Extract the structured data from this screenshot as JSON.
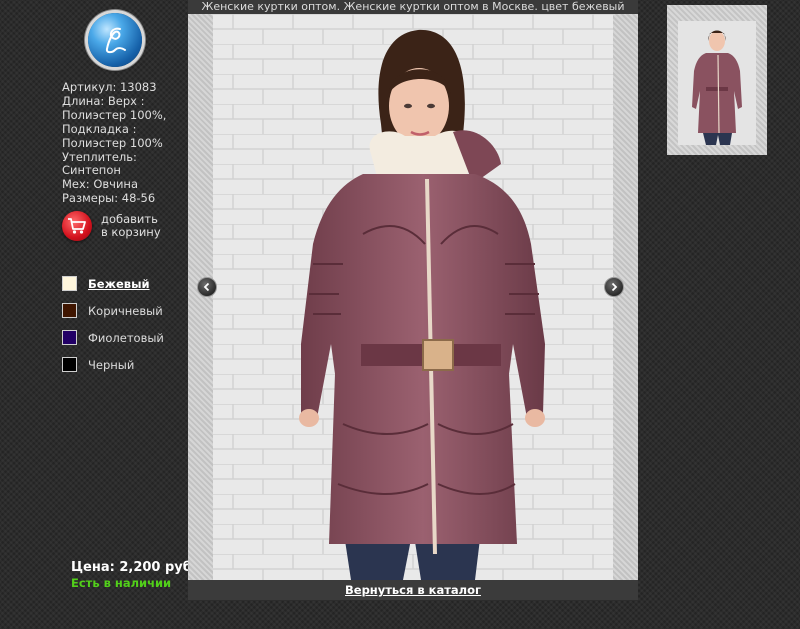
{
  "page": {
    "title": "Женские куртки оптом. Женские куртки оптом в Москве. цвет бежевый"
  },
  "logo": {
    "icon": "script-l-logo-icon",
    "colors": {
      "glow": "#4aa8e8",
      "dark": "#0b3a6e"
    }
  },
  "product": {
    "details": [
      "Артикул: 13083",
      "Длина: Верх :",
      "Полиэстер 100%,",
      "Подкладка :",
      "Полиэстер 100%",
      "Утеплитель:",
      "Синтепон",
      "Мех: Овчина",
      "Размеры: 48-56"
    ],
    "cart": {
      "label_line1": "добавить",
      "label_line2": "в корзину",
      "icon": "shopping-cart-icon"
    },
    "colors": [
      {
        "label": "Бежевый",
        "hex": "#fff6dc",
        "selected": true
      },
      {
        "label": "Коричневый",
        "hex": "#3f1500",
        "selected": false
      },
      {
        "label": "Фиолетовый",
        "hex": "#220066",
        "selected": false
      },
      {
        "label": "Черный",
        "hex": "#000000",
        "selected": false
      }
    ],
    "price": "Цена: 2,200 руб.",
    "availability": "Есть в наличии"
  },
  "viewer": {
    "back_link": "Вернуться в каталог",
    "prev_icon": "chevron-left-icon",
    "next_icon": "chevron-right-icon"
  },
  "theme": {
    "accent_green": "#52d01a",
    "jacket": "#8a5260",
    "background": "#2c2c2c"
  }
}
